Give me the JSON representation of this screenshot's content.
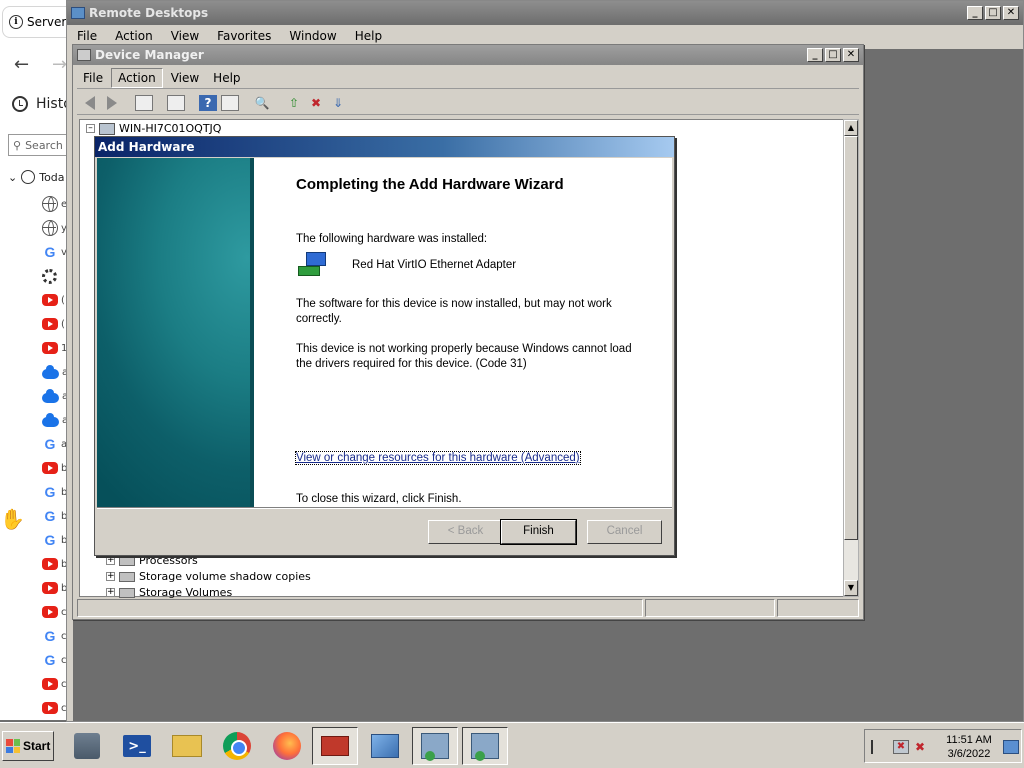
{
  "browser": {
    "tab_title": "Server",
    "history_label": "Histo",
    "search_placeholder": "Search",
    "today_label": "Toda",
    "entries": [
      {
        "icon": "globe-icon",
        "frag": "e"
      },
      {
        "icon": "globe-icon",
        "frag": "y"
      },
      {
        "icon": "google-icon",
        "frag": "v"
      },
      {
        "icon": "gear-icon",
        "frag": ""
      },
      {
        "icon": "youtube-icon",
        "frag": "("
      },
      {
        "icon": "youtube-icon",
        "frag": "("
      },
      {
        "icon": "youtube-icon",
        "frag": "1"
      },
      {
        "icon": "onedrive-icon",
        "frag": "a"
      },
      {
        "icon": "onedrive-icon",
        "frag": "a"
      },
      {
        "icon": "onedrive-icon",
        "frag": "a"
      },
      {
        "icon": "google-icon",
        "frag": "a"
      },
      {
        "icon": "youtube-icon",
        "frag": "b"
      },
      {
        "icon": "google-icon",
        "frag": "b"
      },
      {
        "icon": "google-icon",
        "frag": "b"
      },
      {
        "icon": "google-icon",
        "frag": "b"
      },
      {
        "icon": "youtube-icon",
        "frag": "b"
      },
      {
        "icon": "youtube-icon",
        "frag": "b"
      },
      {
        "icon": "youtube-icon",
        "frag": "c"
      },
      {
        "icon": "google-icon",
        "frag": "c"
      },
      {
        "icon": "google-icon",
        "frag": "c"
      },
      {
        "icon": "youtube-icon",
        "frag": "c"
      },
      {
        "icon": "youtube-icon",
        "frag": "c"
      }
    ]
  },
  "remote_desktops": {
    "title": "Remote Desktops",
    "menu": [
      "File",
      "Action",
      "View",
      "Favorites",
      "Window",
      "Help"
    ]
  },
  "device_manager": {
    "title": "Device Manager",
    "menu": [
      "File",
      "Action",
      "View",
      "Help"
    ],
    "active_menu": "Action",
    "root_node": "WIN-HI7C01OQTJQ",
    "visible_nodes": [
      "Processors",
      "Storage volume shadow copies",
      "Storage Volumes"
    ]
  },
  "wizard": {
    "title": "Add Hardware",
    "heading": "Completing the Add Hardware Wizard",
    "installed_label": "The following hardware was installed:",
    "device_name": "Red Hat VirtIO Ethernet Adapter",
    "software_msg": "The software for this device is now installed, but may not work correctly.",
    "error_msg": "This device is not working properly because Windows cannot load the drivers required for this device. (Code 31)",
    "advanced_link": "View or change resources for this hardware (Advanced)",
    "close_msg": "To close this wizard, click Finish.",
    "back_label": "< Back",
    "finish_label": "Finish",
    "cancel_label": "Cancel"
  },
  "taskbar": {
    "start_label": "Start",
    "apps": [
      {
        "name": "server-manager"
      },
      {
        "name": "powershell"
      },
      {
        "name": "file-explorer"
      },
      {
        "name": "chrome"
      },
      {
        "name": "firefox"
      },
      {
        "name": "toolbox"
      },
      {
        "name": "remote-desktops"
      },
      {
        "name": "network-monitor"
      },
      {
        "name": "network-monitor-2"
      }
    ],
    "time": "11:51 AM",
    "date": "3/6/2022"
  }
}
